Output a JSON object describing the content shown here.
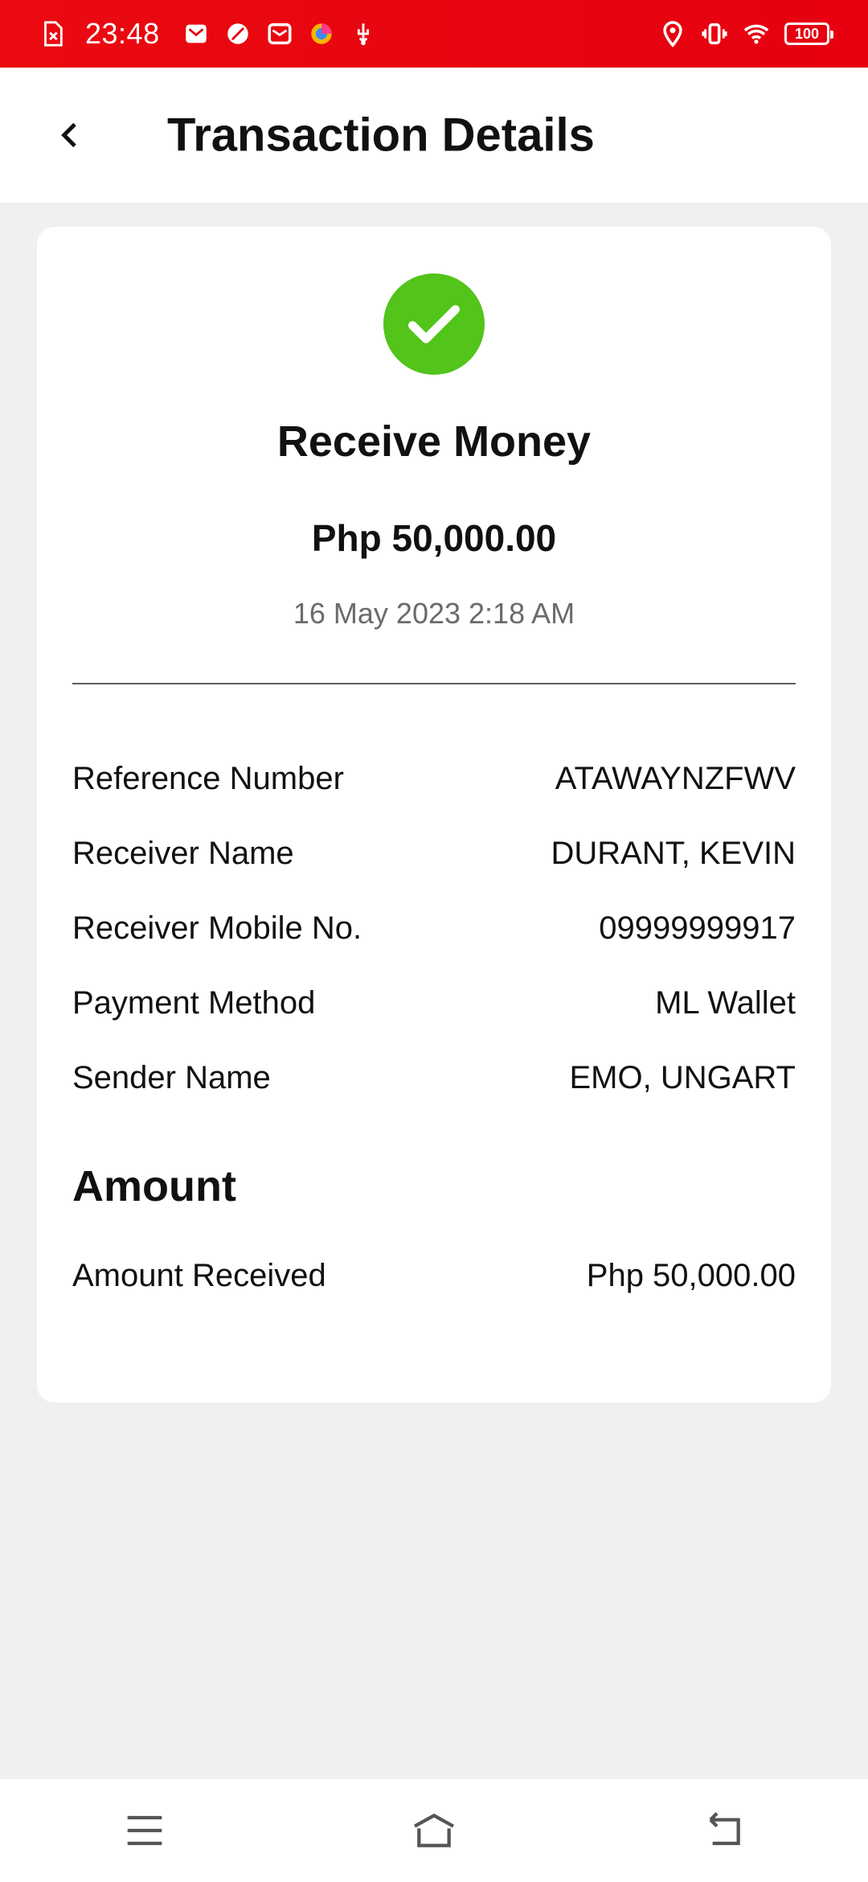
{
  "status_bar": {
    "time": "23:48",
    "battery": "100",
    "left_icons": [
      "sim-error-icon",
      "mail-icon",
      "leaf-icon",
      "mail-alt-icon",
      "browser-icon",
      "usb-icon"
    ],
    "right_icons": [
      "location-icon",
      "vibrate-icon",
      "wifi-icon",
      "battery-icon"
    ]
  },
  "header": {
    "title": "Transaction Details",
    "back_icon": "chevron-left-icon"
  },
  "transaction": {
    "status_icon": "check-circle-icon",
    "type": "Receive Money",
    "amount": "Php 50,000.00",
    "date": "16 May 2023 2:18 AM"
  },
  "details": [
    {
      "label": "Reference Number",
      "value": "ATAWAYNZFWV"
    },
    {
      "label": "Receiver Name",
      "value": "DURANT, KEVIN"
    },
    {
      "label": "Receiver Mobile No.",
      "value": "09999999917"
    },
    {
      "label": "Payment Method",
      "value": "ML Wallet"
    },
    {
      "label": "Sender Name",
      "value": "EMO, UNGART"
    }
  ],
  "amount_section": {
    "title": "Amount",
    "label": "Amount Received",
    "value": "Php 50,000.00"
  },
  "colors": {
    "status_bar": "#e60010",
    "success": "#52c41a",
    "background": "#f0f0f0"
  },
  "nav": {
    "icons": [
      "menu-icon",
      "home-icon",
      "back-icon"
    ]
  }
}
